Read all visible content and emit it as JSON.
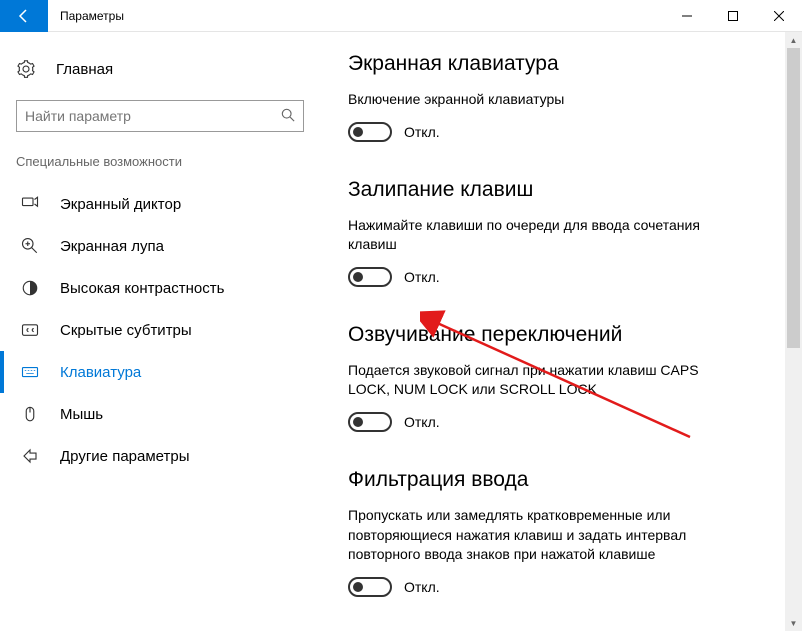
{
  "titlebar": {
    "title": "Параметры"
  },
  "sidebar": {
    "home": "Главная",
    "search_placeholder": "Найти параметр",
    "section": "Специальные возможности",
    "items": [
      {
        "label": "Экранный диктор"
      },
      {
        "label": "Экранная лупа"
      },
      {
        "label": "Высокая контрастность"
      },
      {
        "label": "Скрытые субтитры"
      },
      {
        "label": "Клавиатура"
      },
      {
        "label": "Мышь"
      },
      {
        "label": "Другие параметры"
      }
    ]
  },
  "content": {
    "sections": [
      {
        "heading": "Экранная клавиатура",
        "desc": "Включение экранной клавиатуры",
        "toggle": "Откл."
      },
      {
        "heading": "Залипание клавиш",
        "desc": "Нажимайте клавиши по очереди для ввода сочетания клавиш",
        "toggle": "Откл."
      },
      {
        "heading": "Озвучивание переключений",
        "desc": "Подается звуковой сигнал при нажатии клавиш CAPS LOCK, NUM LOCK или SCROLL LOCK",
        "toggle": "Откл."
      },
      {
        "heading": "Фильтрация ввода",
        "desc": "Пропускать или замедлять кратковременные или повторяющиеся нажатия клавиш и задать интервал повторного ввода знаков при нажатой клавише",
        "toggle": "Откл."
      }
    ]
  }
}
